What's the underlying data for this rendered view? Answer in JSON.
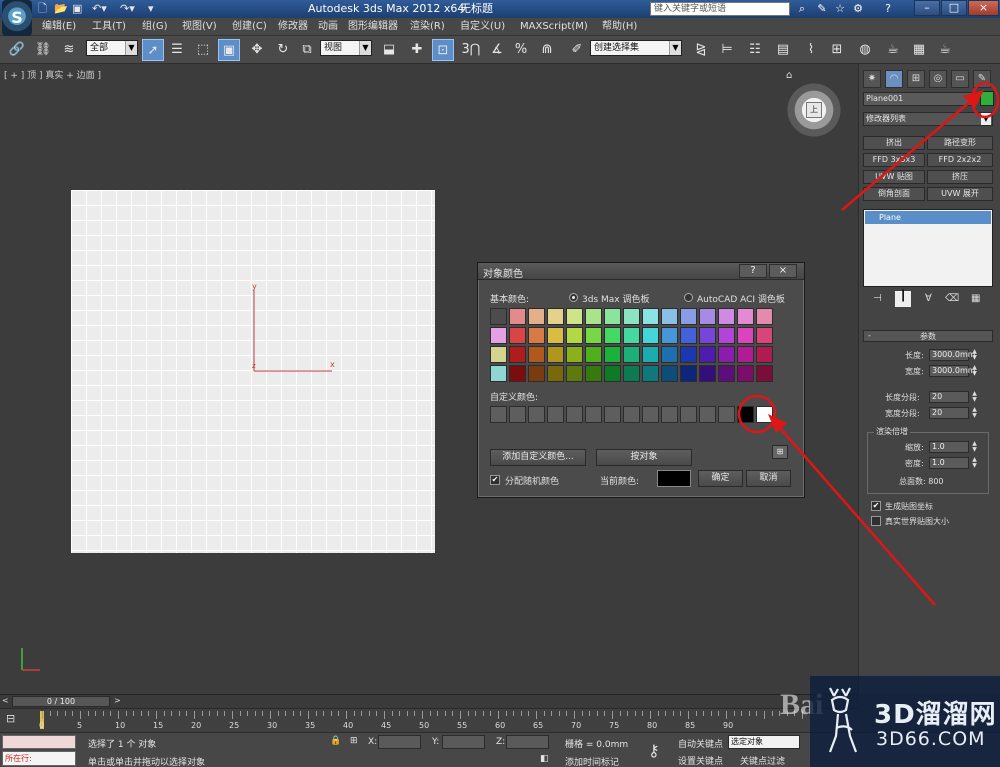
{
  "title_bar": {
    "app_title": "Autodesk 3ds Max  2012 x64",
    "doc_title": "无标题",
    "search_placeholder": "键入关键字或短语",
    "minimize": "–",
    "maximize": "□",
    "close": "×",
    "help": "?"
  },
  "menu": {
    "items": [
      "编辑(E)",
      "工具(T)",
      "组(G)",
      "视图(V)",
      "创建(C)",
      "修改器",
      "动画",
      "图形编辑器",
      "渲染(R)",
      "自定义(U)",
      "MAXScript(M)",
      "帮助(H)"
    ]
  },
  "toolbar": {
    "selection_filter": "全部",
    "ref_coord": "视图",
    "named_selection": "创建选择集"
  },
  "viewport": {
    "label": "[ + ] 顶 ] 真实 + 边面 ]",
    "axis_y": "y",
    "axis_x": "x",
    "axis_z": "z",
    "viewcube_face": "上"
  },
  "dialog": {
    "title": "对象颜色",
    "help": "?",
    "close": "×",
    "basic_colors_label": "基本颜色:",
    "palette_option_1": "3ds Max 调色板",
    "palette_option_2": "AutoCAD ACI 调色板",
    "custom_colors_label": "自定义颜色:",
    "add_custom_button": "添加自定义颜色...",
    "by_object_button": "按对象",
    "assign_random_label": "分配随机颜色",
    "current_color_label": "当前颜色:",
    "ok_button": "确定",
    "cancel_button": "取消",
    "current_color": "#000000",
    "basic_colors": [
      [
        "#4c4c4c",
        "#e48a8a",
        "#e4b08a",
        "#e4d28a",
        "#cfe48a",
        "#a9e48a",
        "#8ae49c",
        "#8ae4c2",
        "#8ae2e4",
        "#8ac0e4",
        "#8a9ce4",
        "#a78ae4",
        "#cf8ae4",
        "#e48ad2",
        "#e48aad"
      ],
      [
        "#e4a0e4",
        "#d84545",
        "#d87a45",
        "#d8bd45",
        "#b2d845",
        "#76d845",
        "#45d864",
        "#45d89f",
        "#45d4d8",
        "#4597d8",
        "#4560d8",
        "#7745d8",
        "#b245d8",
        "#d845bd",
        "#d84578"
      ],
      [
        "#d4d490",
        "#b01c1c",
        "#b0591c",
        "#b0961c",
        "#8ab01c",
        "#50b01c",
        "#1cb03c",
        "#1cb078",
        "#1cacb0",
        "#1c70b0",
        "#1c38b0",
        "#501cb0",
        "#8a1cb0",
        "#b01c96",
        "#b01c52"
      ],
      [
        "#90d4d4",
        "#7a0e0e",
        "#7a3c0e",
        "#7a680e",
        "#5e7a0e",
        "#367a0e",
        "#0e7a28",
        "#0e7a52",
        "#0e787a",
        "#0e4c7a",
        "#0e267a",
        "#360e7a",
        "#5e0e7a",
        "#7a0e68",
        "#7a0e38"
      ]
    ],
    "custom_colors": [
      "#5e5e5e",
      "#5e5e5e",
      "#5e5e5e",
      "#5e5e5e",
      "#5e5e5e",
      "#5e5e5e",
      "#5e5e5e",
      "#5e5e5e",
      "#5e5e5e",
      "#5e5e5e",
      "#5e5e5e",
      "#5e5e5e",
      "#5e5e5e",
      "#000000",
      "#ffffff"
    ]
  },
  "command_panel": {
    "object_name": "Plane001",
    "object_color": "#2fae3a",
    "modifier_list": "修改器列表",
    "modifier_buttons": [
      "挤出",
      "路径变形",
      "FFD 3x3x3",
      "FFD 2x2x2",
      "UVW 贴图",
      "挤压",
      "倒角剖面",
      "UVW 展开"
    ],
    "stack_item": "Plane",
    "params_title": "参数",
    "length_label": "长度:",
    "length_value": "3000.0mm",
    "width_label": "宽度:",
    "width_value": "3000.0mm",
    "length_segs_label": "长度分段:",
    "length_segs_value": "20",
    "width_segs_label": "宽度分段:",
    "width_segs_value": "20",
    "render_mult_label": "渲染倍增",
    "scale_label": "缩放:",
    "scale_value": "1.0",
    "density_label": "密度:",
    "density_value": "1.0",
    "total_faces": "总面数: 800",
    "gen_mapping": "生成贴图坐标",
    "real_world": "真实世界贴图大小"
  },
  "timeline": {
    "frame_display": "0 / 100",
    "ticks": [
      "0",
      "5",
      "10",
      "15",
      "20",
      "25",
      "30",
      "35",
      "40",
      "45",
      "50",
      "55",
      "60",
      "65",
      "70",
      "75",
      "80",
      "85",
      "90"
    ]
  },
  "status_bar": {
    "maxscript_label": "所在行:",
    "selection_status": "选择了 1 个 对象",
    "prompt": "单击或单击并拖动以选择对象",
    "x_label": "X:",
    "y_label": "Y:",
    "z_label": "Z:",
    "grid": "栅格 = 0.0mm",
    "add_time_tag": "添加时间标记",
    "auto_key": "自动关键点",
    "selected": "选定对象",
    "set_key": "设置关键点",
    "key_filters": "关键点过滤"
  },
  "watermark": {
    "brand": "3D溜溜网",
    "domain": "3D66.COM",
    "baidu": "Bai"
  }
}
